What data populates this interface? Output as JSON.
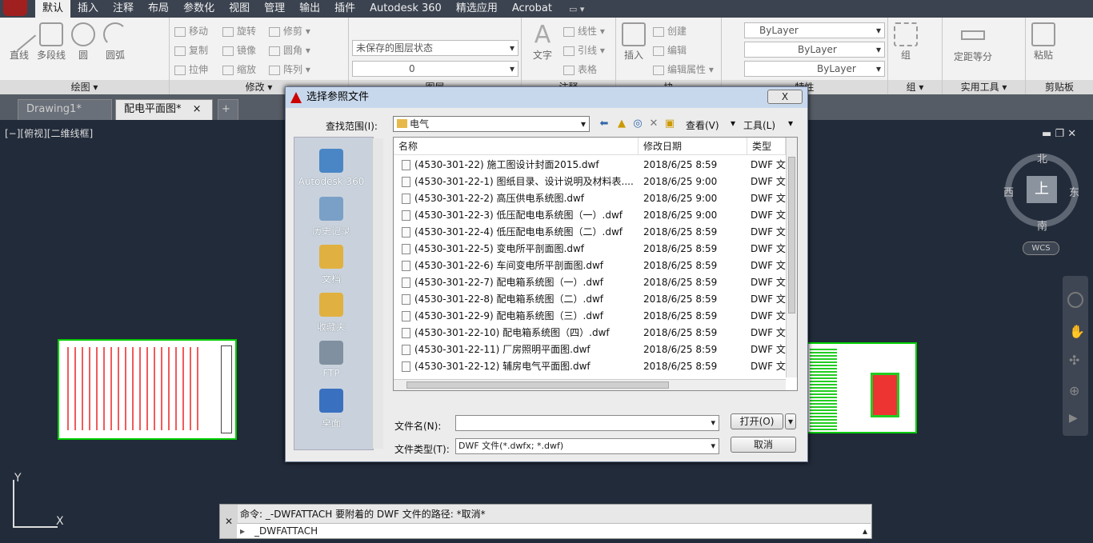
{
  "menubar": {
    "items": [
      "默认",
      "插入",
      "注释",
      "布局",
      "参数化",
      "视图",
      "管理",
      "输出",
      "插件",
      "Autodesk 360",
      "精选应用",
      "Acrobat"
    ],
    "active_index": 0
  },
  "ribbon": {
    "draw": {
      "title": "绘图 ▾",
      "line": "直线",
      "polyline": "多段线",
      "circle": "圆",
      "arc": "圆弧"
    },
    "modify": {
      "title": "修改 ▾",
      "move": "移动",
      "rotate": "旋转",
      "trim": "修剪",
      "copy": "复制",
      "mirror": "镜像",
      "fillet": "圆角",
      "stretch": "拉伸",
      "scale": "缩放",
      "array": "阵列"
    },
    "layers": {
      "title": "图层",
      "state": "未保存的图层状态",
      "current": "0"
    },
    "annotation": {
      "title": "注释",
      "text": "文字",
      "linear": "线性",
      "leader": "引线",
      "table": "表格"
    },
    "block": {
      "title": "块",
      "insert": "插入",
      "create": "创建",
      "edit": "编辑",
      "edit_attr": "编辑属性"
    },
    "properties": {
      "title": "特性",
      "color": "ByLayer",
      "linetype": "ByLayer",
      "lineweight": "ByLayer"
    },
    "groups": {
      "title": "组 ▾",
      "group": "组"
    },
    "utilities": {
      "title": "实用工具 ▾",
      "measure": "定距等分"
    },
    "clipboard": {
      "title": "剪贴板",
      "paste": "粘贴"
    }
  },
  "doc_tabs": [
    {
      "label": "Drawing1*"
    },
    {
      "label": "配电平面图*",
      "close": "×"
    }
  ],
  "canvas": {
    "view_label": "[−][俯视][二维线框]",
    "compass": {
      "north": "北",
      "south": "南",
      "east": "东",
      "west": "西",
      "top": "上"
    },
    "wcs": "WCS",
    "axis_y": "Y",
    "axis_x": "X"
  },
  "command": {
    "history": "命令: _-DWFATTACH 要附着的 DWF 文件的路径: *取消*",
    "input": "_DWFATTACH"
  },
  "dialog": {
    "title": "选择参照文件",
    "close": "X",
    "look_in_label": "查找范围(I):",
    "look_in_value": "电气",
    "view_label": "查看(V)",
    "tools_label": "工具(L)",
    "places": [
      "Autodesk 360",
      "历史记录",
      "文档",
      "收藏夹",
      "FTP",
      "桌面"
    ],
    "columns": {
      "name": "名称",
      "date": "修改日期",
      "type": "类型"
    },
    "files": [
      {
        "name": "(4530-301-22)  施工图设计封面2015.dwf",
        "date": "2018/6/25 8:59",
        "type": "DWF 文"
      },
      {
        "name": "(4530-301-22-1)  图纸目录、设计说明及材料表....",
        "date": "2018/6/25 9:00",
        "type": "DWF 文"
      },
      {
        "name": "(4530-301-22-2)  高压供电系统图.dwf",
        "date": "2018/6/25 9:00",
        "type": "DWF 文"
      },
      {
        "name": "(4530-301-22-3)  低压配电电系统图（一）.dwf",
        "date": "2018/6/25 9:00",
        "type": "DWF 文"
      },
      {
        "name": "(4530-301-22-4)  低压配电电系统图（二）.dwf",
        "date": "2018/6/25 8:59",
        "type": "DWF 文"
      },
      {
        "name": "(4530-301-22-5)  变电所平剖面图.dwf",
        "date": "2018/6/25 8:59",
        "type": "DWF 文"
      },
      {
        "name": "(4530-301-22-6)  车间变电所平剖面图.dwf",
        "date": "2018/6/25 8:59",
        "type": "DWF 文"
      },
      {
        "name": "(4530-301-22-7)  配电箱系统图（一）.dwf",
        "date": "2018/6/25 8:59",
        "type": "DWF 文"
      },
      {
        "name": "(4530-301-22-8)  配电箱系统图（二）.dwf",
        "date": "2018/6/25 8:59",
        "type": "DWF 文"
      },
      {
        "name": "(4530-301-22-9)  配电箱系统图（三）.dwf",
        "date": "2018/6/25 8:59",
        "type": "DWF 文"
      },
      {
        "name": "(4530-301-22-10)  配电箱系统图（四）.dwf",
        "date": "2018/6/25 8:59",
        "type": "DWF 文"
      },
      {
        "name": "(4530-301-22-11)  厂房照明平面图.dwf",
        "date": "2018/6/25 8:59",
        "type": "DWF 文"
      },
      {
        "name": "(4530-301-22-12)  辅房电气平面图.dwf",
        "date": "2018/6/25 8:59",
        "type": "DWF 文"
      }
    ],
    "filename_label": "文件名(N):",
    "filename_value": "",
    "filetype_label": "文件类型(T):",
    "filetype_value": "DWF 文件(*.dwfx; *.dwf)",
    "open_button": "打开(O)",
    "cancel_button": "取消"
  }
}
